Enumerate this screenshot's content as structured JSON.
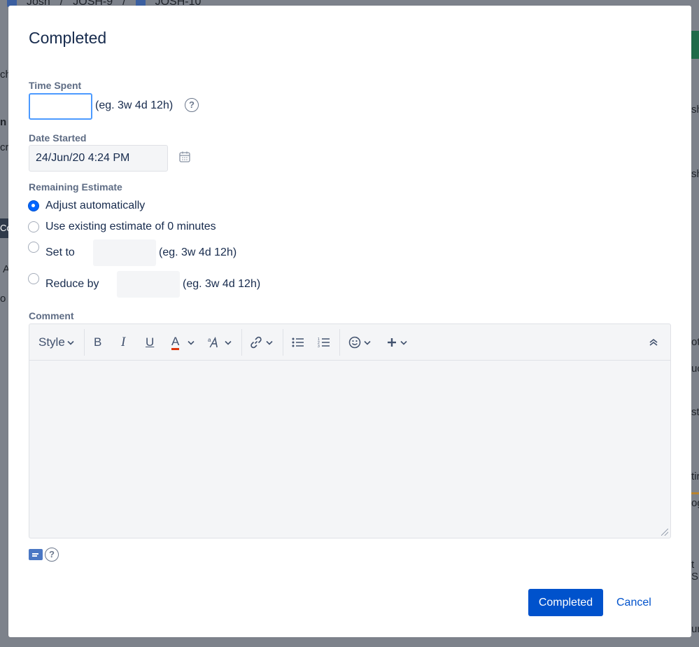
{
  "background": {
    "breadcrumb": [
      "Josh",
      "/",
      "JOSH-9",
      "/",
      "JOSH-10"
    ],
    "fragments_left": [
      "ch",
      "n",
      "cri",
      "Co",
      "A",
      "o t"
    ],
    "fragments_right": [
      "sh",
      "sh",
      "ot",
      "uc",
      "sti",
      "tir",
      "og",
      "t S",
      "ur"
    ]
  },
  "dialog": {
    "title": "Completed",
    "time_spent": {
      "label": "Time Spent",
      "value": "",
      "hint": "(eg. 3w 4d 12h)"
    },
    "date_started": {
      "label": "Date Started",
      "value": "24/Jun/20 4:24 PM"
    },
    "remaining_estimate": {
      "label": "Remaining Estimate",
      "options": [
        {
          "label": "Adjust automatically",
          "checked": true
        },
        {
          "label": "Use existing estimate of 0 minutes",
          "checked": false
        },
        {
          "label": "Set to",
          "checked": false,
          "hint": "(eg. 3w 4d 12h)"
        },
        {
          "label": "Reduce by",
          "checked": false,
          "hint": "(eg. 3w 4d 12h)"
        }
      ]
    },
    "comment": {
      "label": "Comment",
      "toolbar": {
        "style_label": "Style",
        "bold": "B",
        "italic": "I",
        "underline": "U",
        "text_color": "A",
        "text_color_accent": "#de350b"
      },
      "value": ""
    },
    "buttons": {
      "submit": "Completed",
      "cancel": "Cancel"
    }
  },
  "colors": {
    "primary": "#0052cc",
    "focus_border": "#4c9aff"
  }
}
